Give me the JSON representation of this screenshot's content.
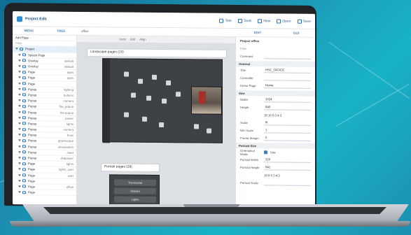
{
  "app": {
    "title": "Project Edit"
  },
  "toolbar": {
    "items": [
      "Test",
      "Tools",
      "New",
      "Open",
      "Save"
    ]
  },
  "tabs": {
    "left": [
      "MENU",
      "TREE"
    ],
    "breadcrumb": "office",
    "right": [
      "EDIT",
      "GUI"
    ]
  },
  "left_panel": {
    "add_page": "Add Page",
    "filter_placeholder": "Filter",
    "rows": [
      {
        "label": "Project",
        "tag": ""
      },
      {
        "label": "Splash Page",
        "tag": ""
      },
      {
        "label": "Overlay",
        "tag": "default"
      },
      {
        "label": "Overlay",
        "tag": "default"
      },
      {
        "label": "Page",
        "tag": "apps"
      },
      {
        "label": "Page",
        "tag": "apps"
      },
      {
        "label": "Page",
        "tag": ""
      },
      {
        "label": "Popup",
        "tag": "lighting"
      },
      {
        "label": "Popup",
        "tag": "buttons"
      },
      {
        "label": "Popup",
        "tag": "camera"
      },
      {
        "label": "Popup",
        "tag": "fire_popup"
      },
      {
        "label": "Popup",
        "tag": "the popup"
      },
      {
        "label": "Popup",
        "tag": "power"
      },
      {
        "label": "Popup",
        "tag": "lights"
      },
      {
        "label": "Popup",
        "tag": "camera"
      },
      {
        "label": "Popup",
        "tag": "hvac"
      },
      {
        "label": "Popup",
        "tag": "ghestscape"
      },
      {
        "label": "Popup",
        "tag": "showswitch"
      },
      {
        "label": "Popup",
        "tag": "meet"
      },
      {
        "label": "Popup",
        "tag": "dvdplayer"
      },
      {
        "label": "Page",
        "tag": "lights"
      },
      {
        "label": "Page",
        "tag": "lights_user"
      },
      {
        "label": "Page",
        "tag": "user"
      },
      {
        "label": "Page",
        "tag": ""
      },
      {
        "label": "Page",
        "tag": "office"
      },
      {
        "label": "Page",
        "tag": ""
      }
    ]
  },
  "center": {
    "toolbar": [
      "Undo",
      "Edit",
      "Align"
    ],
    "landscape_label": "Landscape pages (15)",
    "portrait_label": "Portrait pages (28)",
    "phone_buttons": [
      "Thermostat",
      "Shades",
      "Lights"
    ]
  },
  "right_panel": {
    "header": "Project office",
    "filter_placeholder": "Filter",
    "comment_label": "Comment",
    "general": "General",
    "title_label": "Title",
    "title_value": "HSC_OFFICE",
    "controller_label": "Controller",
    "controller_value": "",
    "home_label": "Home Page",
    "home_value": "Home",
    "size": "Size",
    "width_label": "Width",
    "width_value": "1024",
    "height_label": "Height",
    "height_value": "640",
    "ratios": "16:10 5:3 4:3",
    "scale_label": "Scale",
    "scale_value": "fit",
    "min_label": "Min Scale",
    "min_value": "1",
    "frame_label": "Frame Margin",
    "frame_value": "0",
    "portrait": "Portrait Size",
    "orient_label": "Orientation Mode",
    "orient_value": "Use",
    "pw_label": "Portrait Width",
    "pw_value": "320",
    "ph_label": "Portrait Height",
    "ph_value": "541",
    "pratios": "16:9 5:3 4:3",
    "pscale_label": "Portrait Scale",
    "pscale_value": ""
  }
}
